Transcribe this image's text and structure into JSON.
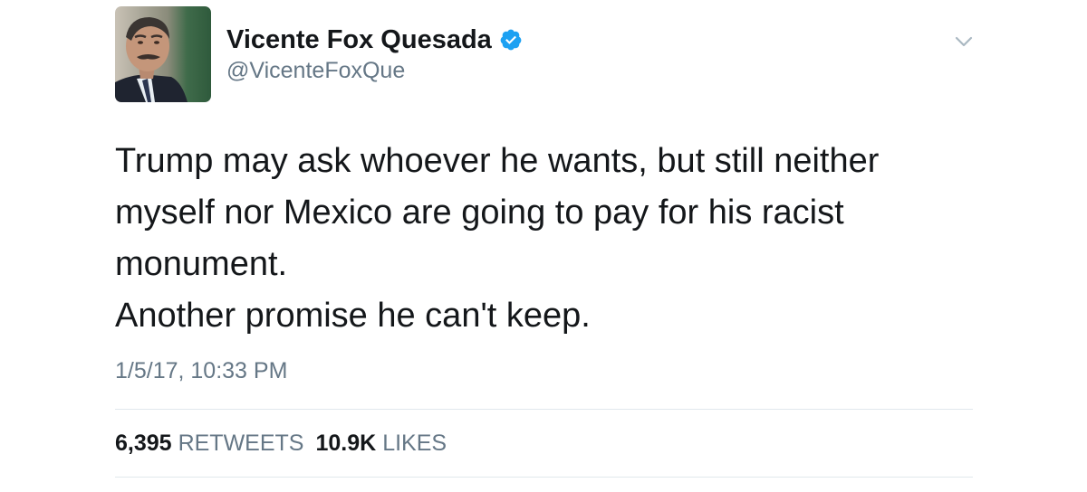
{
  "tweet": {
    "author": {
      "display_name": "Vicente Fox Quesada",
      "handle": "@VicenteFoxQue",
      "verified": true,
      "avatar_icon": "profile-photo"
    },
    "menu_icon": "chevron-down-icon",
    "text_lines": [
      "Trump may ask whoever he wants, but still neither",
      "myself nor Mexico are going to pay for his racist",
      "monument.",
      "Another promise he can't keep."
    ],
    "timestamp": "1/5/17, 10:33 PM",
    "stats": {
      "retweets_count": "6,395",
      "retweets_label": "RETWEETS",
      "likes_count": "10.9K",
      "likes_label": "LIKES"
    }
  },
  "colors": {
    "text_primary": "#14171a",
    "text_secondary": "#657786",
    "verified_blue": "#1da1f2",
    "divider": "#e1e8ed"
  }
}
